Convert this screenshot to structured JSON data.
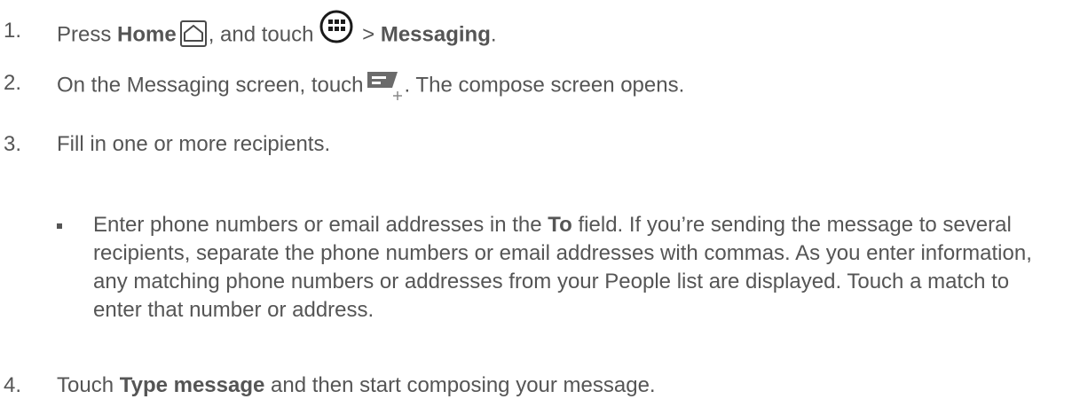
{
  "steps": [
    {
      "num": "1.",
      "text_a": "Press ",
      "bold_a": "Home",
      "text_b": ", and touch",
      "text_c": " > ",
      "bold_b": "Messaging",
      "text_d": ".",
      "icons": [
        "home-icon",
        "apps-icon"
      ]
    },
    {
      "num": "2.",
      "text_a": "On the Messaging screen, touch",
      "text_b": ". The compose screen opens.",
      "icons": [
        "compose-icon"
      ]
    },
    {
      "num": "3.",
      "text_a": "Fill in one or more recipients."
    },
    {
      "num": "4.",
      "text_a": "Touch ",
      "bold_a": "Type message",
      "text_b": " and then start composing your message."
    }
  ],
  "bullet": {
    "text_a": "Enter phone numbers or email addresses in the ",
    "bold_a": "To",
    "text_b": " field. If you’re sending the message to several recipients, separate the phone numbers or email addresses with commas. As you enter information, any matching phone numbers or addresses from your People list are displayed. Touch a match to enter that number or address."
  },
  "colors": {
    "text": "#555555",
    "icon": "#4a4a4a",
    "compose_icon": "#6b6b6b"
  }
}
